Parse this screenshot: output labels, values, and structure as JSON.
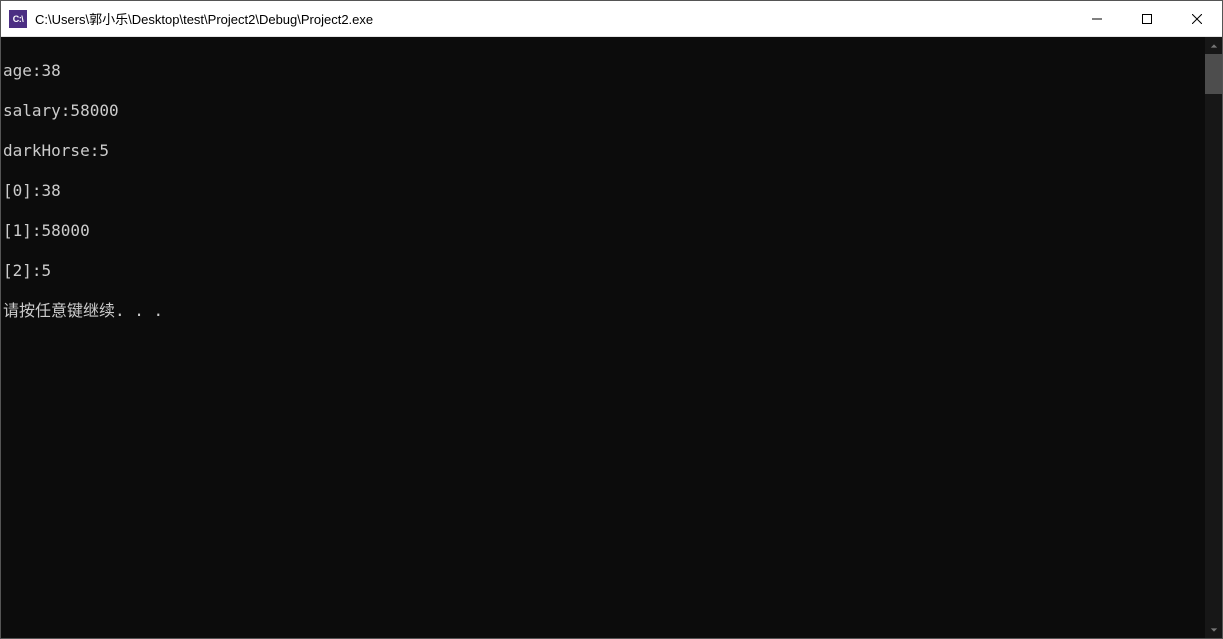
{
  "window": {
    "icon_label": "C:\\",
    "title": "C:\\Users\\郭小乐\\Desktop\\test\\Project2\\Debug\\Project2.exe"
  },
  "console": {
    "lines": [
      "age:38",
      "salary:58000",
      "darkHorse:5",
      "[0]:38",
      "[1]:58000",
      "[2]:5",
      "请按任意键继续. . ."
    ]
  }
}
